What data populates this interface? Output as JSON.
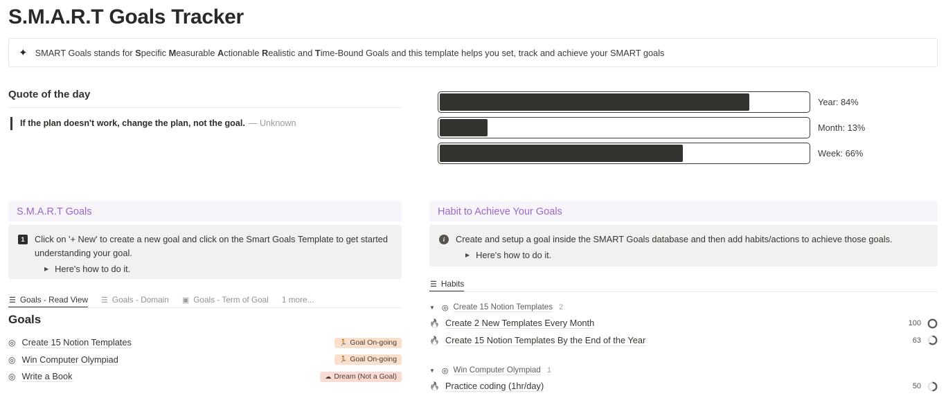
{
  "page": {
    "title": "S.M.A.R.T Goals Tracker"
  },
  "top_callout": {
    "icon": "sparkles-icon",
    "glyph": "✦",
    "text_parts": [
      {
        "t": "SMART Goals stands for ",
        "b": false
      },
      {
        "t": "S",
        "b": true
      },
      {
        "t": "pecific ",
        "b": false
      },
      {
        "t": "M",
        "b": true
      },
      {
        "t": "easurable ",
        "b": false
      },
      {
        "t": "A",
        "b": true
      },
      {
        "t": "ctionable ",
        "b": false
      },
      {
        "t": "R",
        "b": true
      },
      {
        "t": "ealistic and ",
        "b": false
      },
      {
        "t": "T",
        "b": true
      },
      {
        "t": "ime-Bound Goals and this template helps you set, track and achieve your SMART goals",
        "b": false
      }
    ],
    "plain_text": "SMART Goals stands for Specific Measurable Actionable Realistic and Time-Bound Goals and this template helps you set, track and achieve your SMART goals"
  },
  "quote": {
    "heading": "Quote of the day",
    "text": "If the plan doesn't work, change the plan, not the goal.",
    "author": "— Unknown"
  },
  "progress": {
    "bars": [
      {
        "label": "Year: 84%",
        "percent": 84,
        "name": "year"
      },
      {
        "label": "Month: 13%",
        "percent": 13,
        "name": "month"
      },
      {
        "label": "Week: 66%",
        "percent": 66,
        "name": "week"
      }
    ],
    "fill_color": "#353330",
    "border_color": "#3b3935"
  },
  "smart_section": {
    "header": "S.M.A.R.T Goals",
    "header_color": "#9a68c9",
    "header_bg": "#f7f4fa",
    "callout": {
      "icon": "keycap-one-icon",
      "badge": "1",
      "text": "Click on '+ New' to create a new goal and click on the Smart Goals Template to get started understanding your goal.",
      "toggle": "Here's how to do it.",
      "toggle_icon": "triangle-right-icon"
    },
    "tabs": [
      {
        "label": "Goals - Read View",
        "icon": "list-view-icon",
        "glyph": "☰",
        "active": true
      },
      {
        "label": "Goals - Domain",
        "icon": "list-view-icon",
        "glyph": "☰",
        "active": false
      },
      {
        "label": "Goals - Term of Goal",
        "icon": "gallery-view-icon",
        "glyph": "Ὓc",
        "active": false
      },
      {
        "label": "1 more...",
        "icon": "more-views-icon",
        "glyph": "",
        "active": false
      }
    ],
    "list_title": "Goals",
    "goals": [
      {
        "name": "Create 15 Notion Templates",
        "icon": "target-icon",
        "glyph": "◎",
        "tag": "Goal On-going",
        "tag_icon": "runner-icon",
        "tag_glyph": "🏃",
        "tag_bg": "#fbdfcd",
        "tag_color": "#4b3b2f"
      },
      {
        "name": "Win Computer Olympiad",
        "icon": "target-icon",
        "glyph": "◎",
        "tag": "Goal On-going",
        "tag_icon": "runner-icon",
        "tag_glyph": "🏃",
        "tag_bg": "#fbdfcd",
        "tag_color": "#4b3b2f"
      },
      {
        "name": "Write a Book",
        "icon": "target-icon",
        "glyph": "◎",
        "tag": "Dream (Not a Goal)",
        "tag_icon": "cloud-icon",
        "tag_glyph": "☁",
        "tag_bg": "#fbdcd4",
        "tag_color": "#4b3b2f"
      }
    ]
  },
  "habit_section": {
    "header": "Habit to Achieve Your Goals",
    "header_color": "#9a68c9",
    "header_bg": "#f7f4fa",
    "callout": {
      "icon": "info-icon",
      "badge": "i",
      "text": "Create and setup a goal inside the SMART Goals database and then add habits/actions to achieve those goals.",
      "toggle": "Here's how to do it.",
      "toggle_icon": "triangle-right-icon"
    },
    "tabs": [
      {
        "label": "Habits",
        "icon": "list-view-icon",
        "glyph": "☰",
        "active": true
      }
    ],
    "groups": [
      {
        "name": "Create 15 Notion Templates",
        "icon": "target-icon",
        "glyph": "◎",
        "count": "2",
        "toggle_icon": "triangle-down-icon",
        "habits": [
          {
            "name": "Create 2 New Templates Every Month",
            "icon": "flame-icon",
            "glyph": "🔥",
            "value": "100",
            "percent": 100
          },
          {
            "name": "Create 15 Notion Templates By the End of the Year",
            "icon": "flame-icon",
            "glyph": "🔥",
            "value": "63",
            "percent": 63
          }
        ]
      },
      {
        "name": "Win Computer Olympiad",
        "icon": "target-icon",
        "glyph": "◎",
        "count": "1",
        "toggle_icon": "triangle-down-icon",
        "habits": [
          {
            "name": "Practice coding (1hr/day)",
            "icon": "flame-icon",
            "glyph": "🔥",
            "value": "50",
            "percent": 50
          }
        ]
      }
    ]
  }
}
